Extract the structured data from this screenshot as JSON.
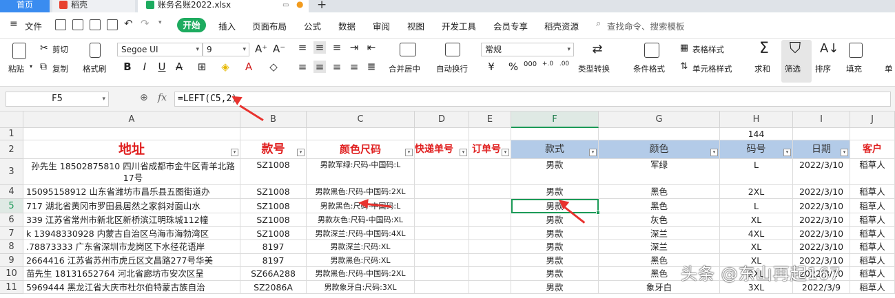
{
  "tabs": {
    "home": "首页",
    "docer": "稻壳",
    "file": "账务名账2022.xlsx",
    "add": "+"
  },
  "menu": {
    "file": "文件",
    "items": [
      "开始",
      "插入",
      "页面布局",
      "公式",
      "数据",
      "审阅",
      "视图",
      "开发工具",
      "会员专享",
      "稻壳资源"
    ],
    "search": "查找命令、搜索模板"
  },
  "ribbon": {
    "paste": "粘贴",
    "cut": "剪切",
    "copy": "复制",
    "format_painter": "格式刷",
    "font": "Segoe UI",
    "size": "9",
    "number_format": "常规",
    "merge": "合并居中",
    "wrap": "自动换行",
    "type_convert": "类型转换",
    "cond_format": "条件格式",
    "table_style": "表格样式",
    "cell_style": "单元格样式",
    "sum": "求和",
    "filter": "筛选",
    "sort": "排序",
    "fill": "填充",
    "sheet": "单"
  },
  "formula_bar": {
    "cell_ref": "F5",
    "fx": "fx",
    "formula": "=LEFT(C5,2)"
  },
  "columns": [
    "A",
    "B",
    "C",
    "D",
    "E",
    "F",
    "G",
    "H",
    "I",
    "J"
  ],
  "row_numbers": [
    "1",
    "2",
    "3",
    "4",
    "5",
    "6",
    "7",
    "8",
    "9",
    "10",
    "11"
  ],
  "row1_h": "144",
  "headers": {
    "A": "地址",
    "B": "款号",
    "C": "颜色尺码",
    "D": "快递单号",
    "E": "订单号",
    "F": "款式",
    "G": "颜色",
    "H": "码号",
    "I": "日期",
    "J": "客户"
  },
  "rows": [
    {
      "a": "孙先生 18502875810  四川省成都市金牛区青羊北路17号",
      "b": "SZ1008",
      "c": "男款军绿:尺码-中国码:L",
      "f": "男款",
      "g": "军绿",
      "h": "L",
      "i": "2022/3/10",
      "j": "稻草人"
    },
    {
      "a": "15095158912  山东省潍坊市昌乐县五图街道办",
      "b": "SZ1008",
      "c": "男款黑色:尺码-中国码:2XL",
      "f": "男款",
      "g": "黑色",
      "h": "2XL",
      "i": "2022/3/10",
      "j": "稻草人"
    },
    {
      "a": "717  湖北省黄冈市罗田县居然之家斜对面山水",
      "b": "SZ1008",
      "c": "男款黑色:尺码-中国码:L",
      "f": "男款",
      "g": "黑色",
      "h": "L",
      "i": "2022/3/10",
      "j": "稻草人"
    },
    {
      "a": "339  江苏省常州市新北区新桥滨江明珠城112幢",
      "b": "SZ1008",
      "c": "男款灰色:尺码-中国码:XL",
      "f": "男款",
      "g": "灰色",
      "h": "XL",
      "i": "2022/3/10",
      "j": "稻草人"
    },
    {
      "a": "k 13948330928  内蒙古自治区乌海市海勃湾区",
      "b": "SZ1008",
      "c": "男款深兰:尺码-中国码:4XL",
      "f": "男款",
      "g": "深兰",
      "h": "4XL",
      "i": "2022/3/10",
      "j": "稻草人"
    },
    {
      "a": ".78873333  广东省深圳市龙岗区下水径花语岸",
      "b": "8197",
      "c": "男款深兰:尺码:XL",
      "f": "男款",
      "g": "深兰",
      "h": "XL",
      "i": "2022/3/10",
      "j": "稻草人"
    },
    {
      "a": "2664416  江苏省苏州市虎丘区文昌路277号华美",
      "b": "8197",
      "c": "男款黑色:尺码:XL",
      "f": "男款",
      "g": "黑色",
      "h": "XL",
      "i": "2022/3/10",
      "j": "稻草人"
    },
    {
      "a": "苗先生 18131652764  河北省廊坊市安次区呈",
      "b": "SZ66A288",
      "c": "男款黑色:尺码-中国码:2XL",
      "f": "男款",
      "g": "黑色",
      "h": "2XL",
      "i": "2022/3/10",
      "j": "稻草人"
    },
    {
      "a": "5969444  黑龙江省大庆市杜尔伯特蒙古族自治",
      "b": "SZ2086A",
      "c": "男款象牙白:尺码:3XL",
      "f": "男款",
      "g": "象牙白",
      "h": "3XL",
      "i": "2022/3/9",
      "j": "稻草人"
    }
  ],
  "watermark": "头条 @东山再起167"
}
